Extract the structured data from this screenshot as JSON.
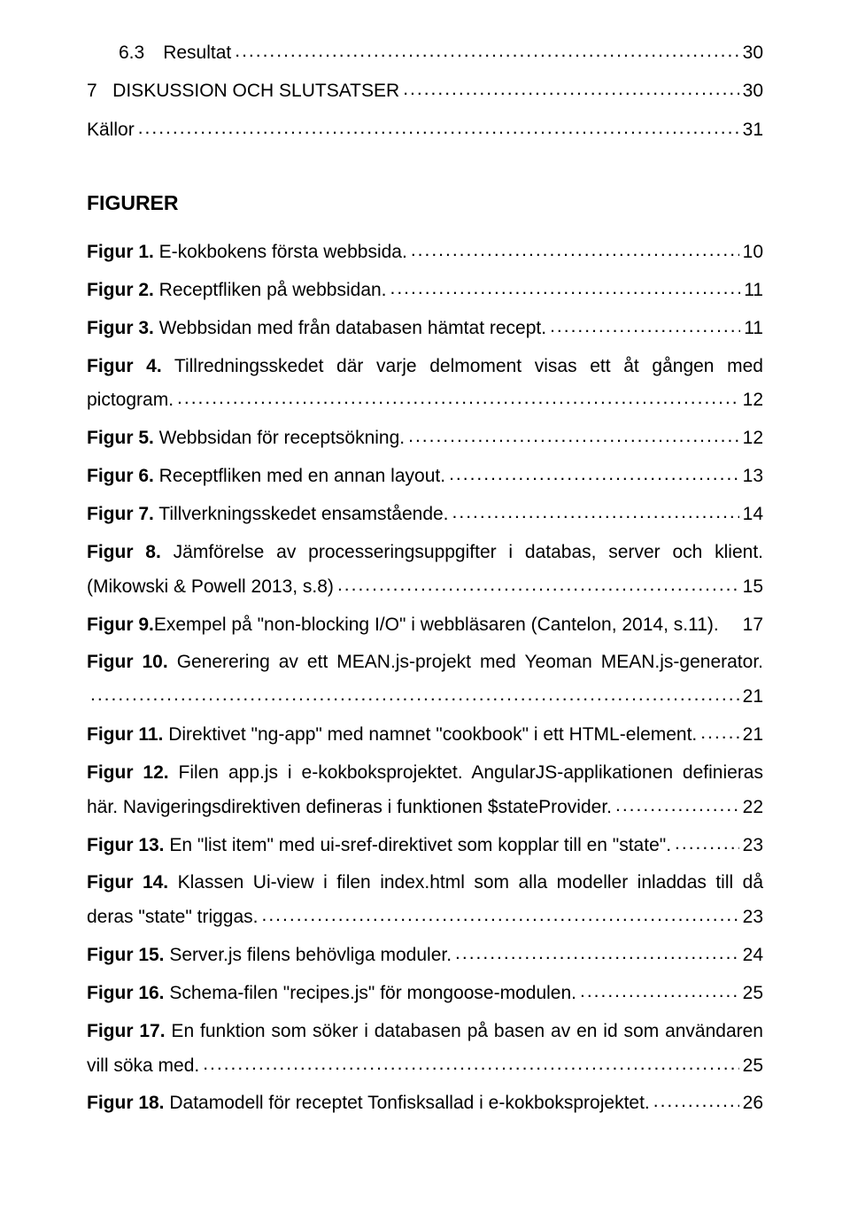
{
  "toc": [
    {
      "indent": 1,
      "label": "6.3 Resultat",
      "page": "30"
    },
    {
      "indent": 0,
      "label": "7   DISKUSSION OCH SLUTSATSER",
      "page": "30"
    },
    {
      "indent": 0,
      "label": "Källor",
      "page": "31"
    }
  ],
  "figHeading": "FIGURER",
  "figures": [
    {
      "bold": "Figur 1.",
      "text": " E-kokbokens första webbsida.",
      "page": "10"
    },
    {
      "bold": "Figur 2.",
      "text": " Receptfliken på webbsidan.",
      "page": "11"
    },
    {
      "bold": "Figur 3.",
      "text": " Webbsidan med från databasen hämtat recept.",
      "page": "11"
    },
    {
      "bold": "Figur 4.",
      "pretail": " Tillredningsskedet där varje delmoment visas ett åt gången med",
      "tail": "pictogram.",
      "page": "12",
      "multi": true
    },
    {
      "bold": "Figur 5.",
      "text": " Webbsidan för receptsökning.",
      "page": "12"
    },
    {
      "bold": "Figur 6.",
      "text": " Receptfliken med en annan layout.",
      "page": "13"
    },
    {
      "bold": "Figur 7.",
      "text": " Tillverkningsskedet ensamstående.",
      "page": "14"
    },
    {
      "bold": "Figur 8.",
      "pretail": " Jämförelse av processeringsuppgifter i databas, server och klient.",
      "tail": "(Mikowski & Powell 2013, s.8)",
      "page": "15",
      "multi": true
    },
    {
      "bold": "Figur 9.",
      "text": "Exempel på \"non-blocking I/O\" i webbläsaren (Cantelon, 2014, s.11).",
      "page": "17",
      "noleader": true
    },
    {
      "bold": "Figur 10.",
      "pretail": " Generering av ett MEAN.js-projekt med Yeoman MEAN.js-generator.",
      "tail": "",
      "page": "21",
      "multi": true
    },
    {
      "bold": "Figur 11.",
      "text": " Direktivet \"ng-app\" med namnet \"cookbook\" i ett HTML-element.",
      "page": "21"
    },
    {
      "bold": "Figur 12.",
      "pretail": " Filen app.js i e-kokboksprojektet. AngularJS-applikationen definieras",
      "tail": "här. Navigeringsdirektiven defineras i funktionen $stateProvider.",
      "page": "22",
      "multi": true
    },
    {
      "bold": "Figur 13.",
      "text": " En \"list item\" med ui-sref-direktivet som kopplar till en \"state\".",
      "page": "23"
    },
    {
      "bold": "Figur 14.",
      "pretail": " Klassen Ui-view i filen index.html som alla modeller inladdas till då",
      "tail": "deras \"state\" triggas.",
      "page": "23",
      "multi": true
    },
    {
      "bold": "Figur 15.",
      "text": " Server.js filens behövliga moduler.",
      "page": "24"
    },
    {
      "bold": "Figur 16.",
      "text": " Schema-filen \"recipes.js\" för mongoose-modulen.",
      "page": "25"
    },
    {
      "bold": "Figur 17.",
      "pretail": " En funktion som söker i databasen på basen av en id som användaren",
      "tail": "vill söka med.",
      "page": "25",
      "multi": true
    },
    {
      "bold": "Figur 18.",
      "text": " Datamodell för receptet Tonfisksallad i e-kokboksprojektet.",
      "page": "26"
    }
  ]
}
